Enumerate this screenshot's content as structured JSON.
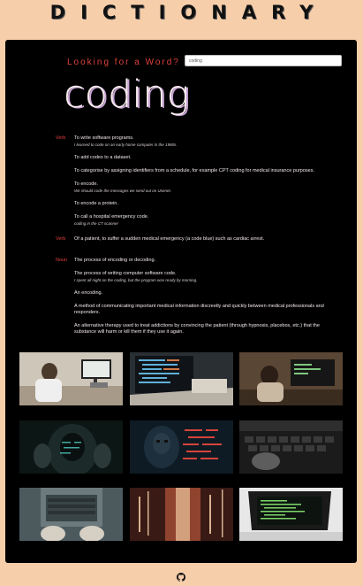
{
  "header": {
    "logo": "DICTIONARY"
  },
  "search": {
    "prompt": "Looking for a Word?",
    "value": "coding"
  },
  "result": {
    "word": "coding",
    "entries": [
      {
        "pos": "Verb",
        "definitions": [
          {
            "text": "To write software programs.",
            "example": "I learned to code on an early home computer in the 1980s."
          },
          {
            "text": "To add codes to a dataset.",
            "example": ""
          },
          {
            "text": "To categorise by assigning identifiers from a schedule, for example CPT coding for medical insurance purposes.",
            "example": ""
          },
          {
            "text": "To encode.",
            "example": "We should code the messages we send out on Usenet."
          },
          {
            "text": "To encode a protein.",
            "example": ""
          },
          {
            "text": "To call a hospital emergency code.",
            "example": "coding in the CT scanner"
          }
        ]
      },
      {
        "pos": "Verb",
        "definitions": [
          {
            "text": "Of a patient, to suffer a sudden medical emergency (a code blue) such as cardiac arrest.",
            "example": ""
          }
        ]
      },
      {
        "pos": "Noun",
        "definitions": [
          {
            "text": "The process of encoding or decoding.",
            "example": ""
          },
          {
            "text": "The process of writing computer software code.",
            "example": "I spent all night on the coding, but the program was ready by morning."
          },
          {
            "text": "An encoding.",
            "example": ""
          },
          {
            "text": "A method of communicating important medical information discreetly and quickly between medical professionals and responders.",
            "example": ""
          },
          {
            "text": "An alternative therapy used to treat addictions by convincing the patient (through hypnosis, placebos, etc.) that the substance will harm or kill them if they use it again.",
            "example": ""
          }
        ]
      }
    ]
  },
  "photos": [
    "person-at-desk-with-monitor",
    "laptop-with-code-closeup",
    "person-at-monitor-workspace",
    "hooded-figure-with-code-projection",
    "masked-hacker-with-red-code",
    "keyboard-closeup-dark",
    "hands-typing-on-laptop",
    "blurred-red-light-trails",
    "laptop-screen-with-code"
  ],
  "footer": {
    "icon": "github-icon"
  }
}
